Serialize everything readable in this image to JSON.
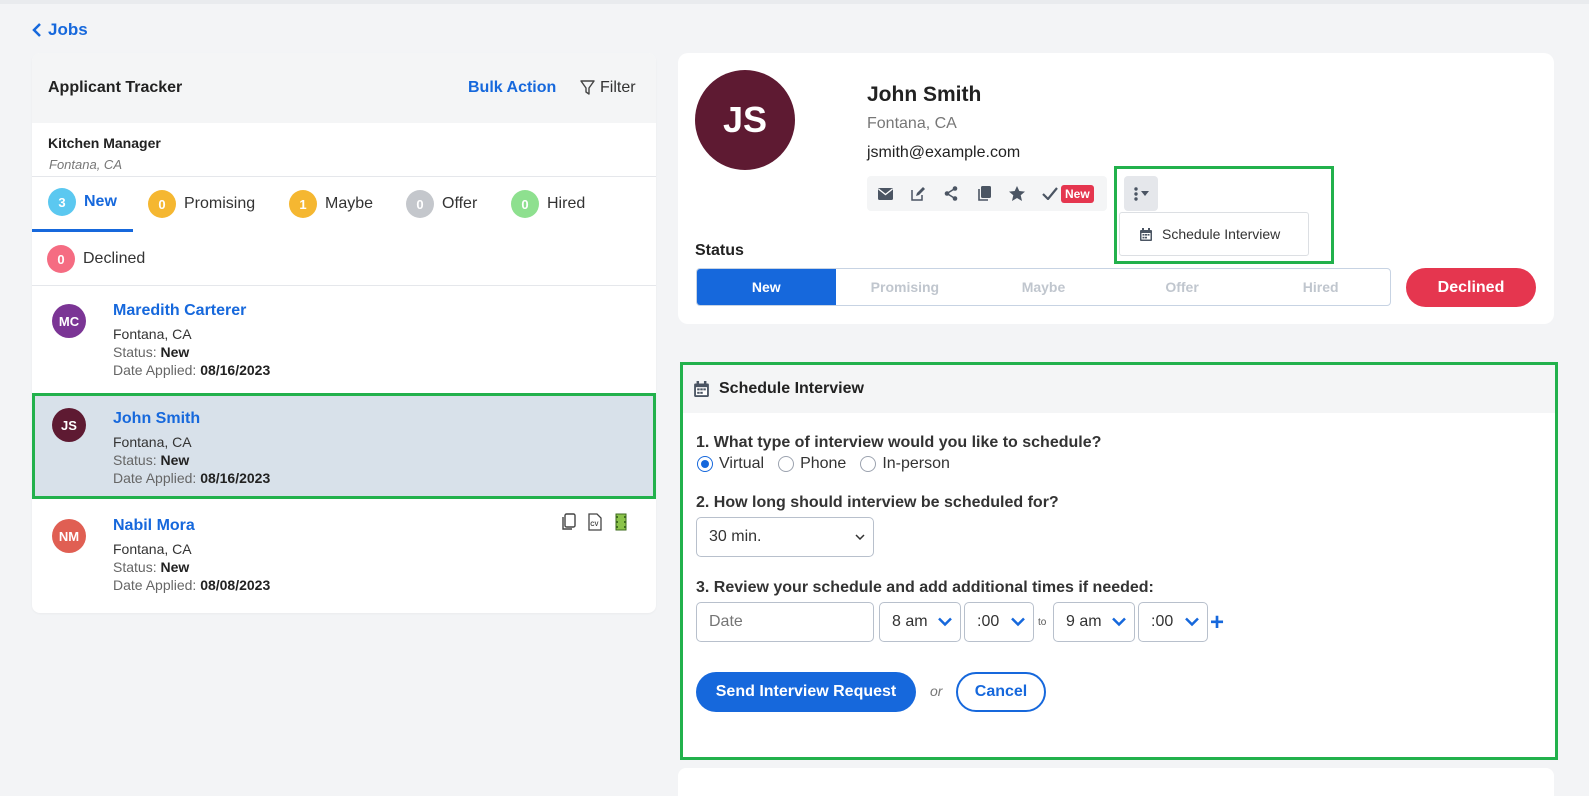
{
  "nav": {
    "back_label": "Jobs"
  },
  "tracker": {
    "title": "Applicant Tracker",
    "bulk_action": "Bulk Action",
    "filter": "Filter",
    "job_title": "Kitchen Manager",
    "job_location": "Fontana, CA",
    "tabs": [
      {
        "label": "New",
        "count": "3",
        "color": "#5bc8f0"
      },
      {
        "label": "Promising",
        "count": "0",
        "color": "#f5b731"
      },
      {
        "label": "Maybe",
        "count": "1",
        "color": "#f5b731"
      },
      {
        "label": "Offer",
        "count": "0",
        "color": "#c4c7cc"
      },
      {
        "label": "Hired",
        "count": "0",
        "color": "#8ee08f"
      },
      {
        "label": "Declined",
        "count": "0",
        "color": "#f56c82"
      }
    ],
    "applicants": [
      {
        "initials": "MC",
        "name": "Maredith Carterer",
        "location": "Fontana, CA",
        "status_label": "Status:",
        "status": "New",
        "date_label": "Date Applied:",
        "date": "08/16/2023",
        "avatar_color": "#7b3595"
      },
      {
        "initials": "JS",
        "name": "John Smith",
        "location": "Fontana, CA",
        "status_label": "Status:",
        "status": "New",
        "date_label": "Date Applied:",
        "date": "08/16/2023",
        "avatar_color": "#5e1a32"
      },
      {
        "initials": "NM",
        "name": "Nabil Mora",
        "location": "Fontana, CA",
        "status_label": "Status:",
        "status": "New",
        "date_label": "Date Applied:",
        "date": "08/08/2023",
        "avatar_color": "#e05f53"
      }
    ]
  },
  "profile": {
    "initials": "JS",
    "name": "John Smith",
    "location": "Fontana, CA",
    "email": "jsmith@example.com",
    "new_tag": "New",
    "dropdown_item": "Schedule Interview",
    "status_label": "Status",
    "statuses": [
      "New",
      "Promising",
      "Maybe",
      "Offer",
      "Hired"
    ],
    "active_status": "New",
    "declined_label": "Declined"
  },
  "schedule": {
    "title": "Schedule Interview",
    "q1": "1. What type of interview would you like to schedule?",
    "options": [
      "Virtual",
      "Phone",
      "In-person"
    ],
    "selected_option": "Virtual",
    "q2": "2. How long should interview be scheduled for?",
    "duration": "30 min.",
    "q3": "3. Review your schedule and add additional times if needed:",
    "date_placeholder": "Date",
    "start_hour": "8 am",
    "start_min": ":00",
    "to_label": "to",
    "end_hour": "9 am",
    "end_min": ":00",
    "add_symbol": "+",
    "send_label": "Send Interview Request",
    "or_label": "or",
    "cancel_label": "Cancel"
  },
  "colors": {
    "accent": "#1668dc",
    "danger": "#e5364f",
    "highlight": "#22b14c"
  }
}
